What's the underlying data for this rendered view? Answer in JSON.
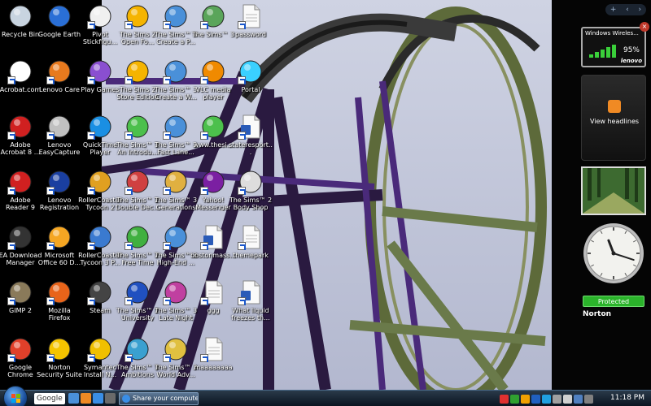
{
  "desktop": {
    "icons": [
      {
        "label": "Recycle Bin",
        "icon": "recycle-bin-icon",
        "color": "#c8d4e0"
      },
      {
        "label": "Google Earth",
        "icon": "google-earth-icon",
        "color": "#2a6fd6"
      },
      {
        "label": "Pivot Stickfigu...",
        "icon": "pivot-icon",
        "color": "#f0f0f0"
      },
      {
        "label": "The Sims 2 Open Fo...",
        "icon": "sims2-icon",
        "color": "#f5b400"
      },
      {
        "label": "The Sims™ 3 Create a P...",
        "icon": "sims3-icon",
        "color": "#4a90d9"
      },
      {
        "label": "The Sims™ 3",
        "icon": "sims3-box-icon",
        "color": "#5aa55a"
      },
      {
        "label": "password",
        "icon": "document-icon",
        "color": "#ffffff"
      },
      {
        "label": "Acrobat.com",
        "icon": "acrobat-com-icon",
        "color": "#ffffff"
      },
      {
        "label": "Lenovo Care",
        "icon": "lenovo-care-icon",
        "color": "#e87a1e"
      },
      {
        "label": "Play Games",
        "icon": "play-games-icon",
        "color": "#8a4fd0"
      },
      {
        "label": "The Sims 2 Store Edition",
        "icon": "sims2-store-icon",
        "color": "#f5b400"
      },
      {
        "label": "The Sims™ 3 Create a W...",
        "icon": "sims3-icon",
        "color": "#4a90d9"
      },
      {
        "label": "VLC media player",
        "icon": "vlc-icon",
        "color": "#f08a00"
      },
      {
        "label": "Portal",
        "icon": "portal-icon",
        "color": "#3ad0ff"
      },
      {
        "label": "Adobe Acrobat 8 ...",
        "icon": "adobe-acrobat-icon",
        "color": "#d02020"
      },
      {
        "label": "Lenovo EasyCapture",
        "icon": "camera-icon",
        "color": "#c0c0c0"
      },
      {
        "label": "QuickTime Player",
        "icon": "quicktime-icon",
        "color": "#1a8fe3"
      },
      {
        "label": "The Sims™ 3 An Introdu...",
        "icon": "sims3-plumbob-icon",
        "color": "#4cc04c"
      },
      {
        "label": "The Sims™ 3 Fast Lane...",
        "icon": "sims3-icon",
        "color": "#4a90d9"
      },
      {
        "label": "www.thesi...",
        "icon": "sims-web-icon",
        "color": "#4cc04c"
      },
      {
        "label": "stateresport...",
        "icon": "word-doc-icon",
        "color": "#2a5bb8"
      },
      {
        "label": "Adobe Reader 9",
        "icon": "adobe-reader-icon",
        "color": "#d02020"
      },
      {
        "label": "Lenovo Registration",
        "icon": "lenovo-registration-icon",
        "color": "#1a3fa0"
      },
      {
        "label": "RollerCoaster Tycoon 2",
        "icon": "rct2-icon",
        "color": "#e0a020"
      },
      {
        "label": "The Sims™ 2 Double Dec...",
        "icon": "sims2-deluxe-icon",
        "color": "#d04040"
      },
      {
        "label": "The Sims™ 3 Generations",
        "icon": "sims3-generations-icon",
        "color": "#e0b040"
      },
      {
        "label": "Yahoo! Messenger",
        "icon": "yahoo-messenger-icon",
        "color": "#7b1fa2"
      },
      {
        "label": "The Sims™ 2 Body Shop",
        "icon": "sims2-bodyshop-icon",
        "color": "#dddddd"
      },
      {
        "label": "EA Download Manager",
        "icon": "ea-icon",
        "color": "#333333"
      },
      {
        "label": "Microsoft Office 60 D...",
        "icon": "office-icon",
        "color": "#f5a623"
      },
      {
        "label": "RollerCoaster Tycoon 3 P...",
        "icon": "rct3-icon",
        "color": "#3a7ad0"
      },
      {
        "label": "The Sims™ 2 Free Time",
        "icon": "sims2-freetime-icon",
        "color": "#40b040"
      },
      {
        "label": "The Sims™ 3 High-End ...",
        "icon": "sims3-icon",
        "color": "#4a90d9"
      },
      {
        "label": "bostonmass...",
        "icon": "word-doc-icon",
        "color": "#2a5bb8"
      },
      {
        "label": "themepark",
        "icon": "document-icon",
        "color": "#ffffff"
      },
      {
        "label": "GIMP 2",
        "icon": "gimp-icon",
        "color": "#8a7a5a"
      },
      {
        "label": "Mozilla Firefox",
        "icon": "firefox-icon",
        "color": "#e8641a"
      },
      {
        "label": "Steam",
        "icon": "steam-icon",
        "color": "#444444"
      },
      {
        "label": "The Sims™ 2 University",
        "icon": "sims2-university-icon",
        "color": "#2050c0"
      },
      {
        "label": "The Sims™ 3 Late Night",
        "icon": "sims3-latenight-icon",
        "color": "#c040a0"
      },
      {
        "label": "ggg",
        "icon": "document-icon",
        "color": "#ffffff"
      },
      {
        "label": "What liquid freezes th...",
        "icon": "word-doc-icon",
        "color": "#2a5bb8"
      },
      {
        "label": "Google Chrome",
        "icon": "chrome-icon",
        "color": "#e0402a"
      },
      {
        "label": "Norton Security Suite",
        "icon": "norton-icon",
        "color": "#f5c400"
      },
      {
        "label": "Symantec Install N...",
        "icon": "symantec-icon",
        "color": "#f0c000"
      },
      {
        "label": "The Sims™ 3 Ambitions",
        "icon": "sims3-ambitions-icon",
        "color": "#3aa0d0"
      },
      {
        "label": "The Sims™ 3 World Adv...",
        "icon": "sims3-worldadv-icon",
        "color": "#e0c040"
      },
      {
        "label": "maaaaaaaa",
        "icon": "document-icon",
        "color": "#ffffff"
      }
    ]
  },
  "sidebar": {
    "controls": [
      "+",
      "‹",
      "›"
    ],
    "wifi": {
      "title": "Windows Wireles...",
      "percent": "95%",
      "brand": "lenovo",
      "close": "×",
      "signal_level": 0.95
    },
    "feeds": {
      "label": "View headlines"
    },
    "clock": {
      "hour": 11,
      "minute": 18
    },
    "norton": {
      "status": "Protected",
      "brand": "Norton"
    }
  },
  "taskbar": {
    "search_label": "Google",
    "task_title": "Share your compute...",
    "time": "11:18 PM",
    "tray_colors": [
      "#e03030",
      "#30a030",
      "#f0a000",
      "#2060c0",
      "#20a0e0",
      "#a0a0a0",
      "#d0d0d0",
      "#5080c0",
      "#808080"
    ],
    "quicklaunch_colors": [
      "#4a90d9",
      "#f08a24",
      "#3a8ee6",
      "#6a6a6a"
    ]
  }
}
